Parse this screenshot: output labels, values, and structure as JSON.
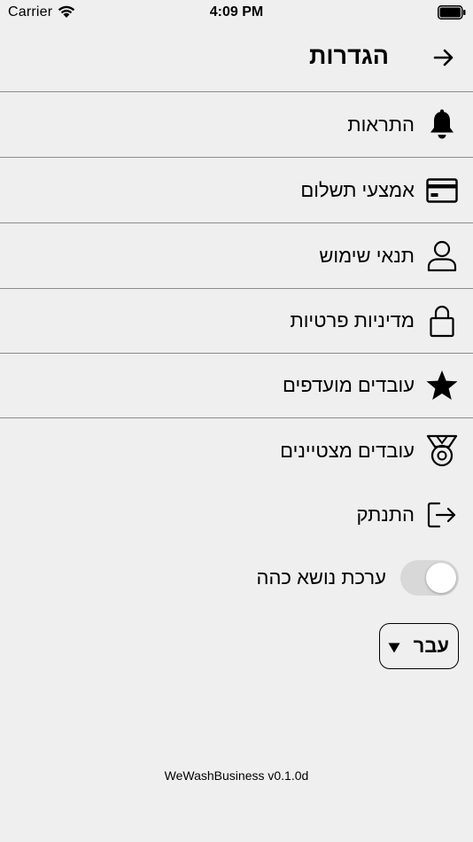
{
  "status_bar": {
    "carrier": "Carrier",
    "time": "4:09 PM"
  },
  "header": {
    "title": "הגדרות",
    "back_icon": "arrow-right-icon"
  },
  "menu": [
    {
      "label": "התראות",
      "icon": "bell-icon"
    },
    {
      "label": "אמצעי תשלום",
      "icon": "credit-card-icon"
    },
    {
      "label": "תנאי שימוש",
      "icon": "user-icon"
    },
    {
      "label": "מדיניות פרטיות",
      "icon": "lock-icon"
    },
    {
      "label": "עובדים מועדפים",
      "icon": "star-icon"
    },
    {
      "label": "עובדים מצטיינים",
      "icon": "medal-icon"
    },
    {
      "label": "התנתק",
      "icon": "logout-icon"
    }
  ],
  "dark_theme": {
    "label": "ערכת נושא כהה",
    "enabled": false
  },
  "language": {
    "selected": "עבר"
  },
  "footer": {
    "version": "WeWashBusiness v0.1.0d"
  },
  "colors": {
    "background": "#efefef",
    "divider": "#8c8c8c",
    "toggle_off": "#d8d8d8"
  }
}
